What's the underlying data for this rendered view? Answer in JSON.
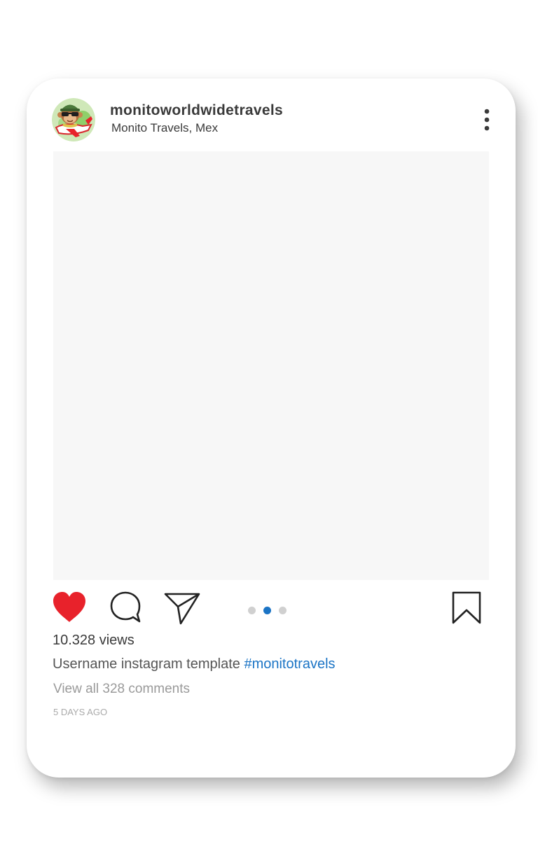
{
  "post": {
    "username": "monitoworldwidetravels",
    "location": "Monito Travels, Mex",
    "views": "10.328 views",
    "caption_text": "Username instagram template ",
    "hashtag": "#monitotravels",
    "comments_link": "View all 328 comments",
    "timestamp": "5 DAYS AGO"
  },
  "icons": {
    "avatar": "monkey-pilot-avatar",
    "more": "vertical-ellipsis-icon",
    "like": "heart-icon",
    "comment": "comment-bubble-icon",
    "share": "paper-plane-icon",
    "save": "bookmark-icon"
  },
  "carousel": {
    "total": 3,
    "active_index": 2
  },
  "colors": {
    "like_red": "#e8222b",
    "hashtag_blue": "#1b74c5",
    "active_dot": "#1b74c5",
    "inactive_dot": "#d0d0d0",
    "media_placeholder": "#f7f7f7"
  }
}
